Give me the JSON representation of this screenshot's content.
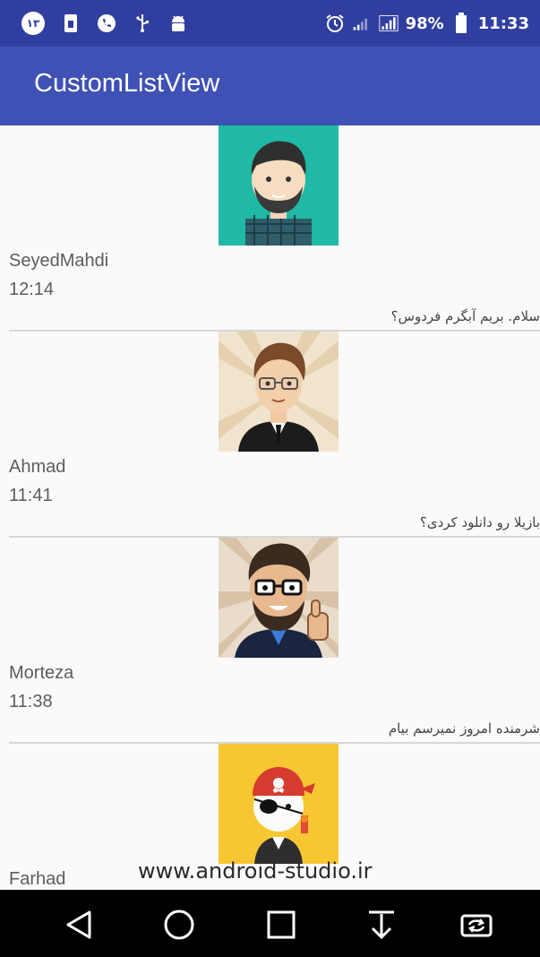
{
  "status_bar": {
    "left_icons": [
      "notification-count-badge",
      "sim-icon",
      "phone-icon",
      "usb-icon",
      "android-debug-icon"
    ],
    "badge_text": "۱۳",
    "battery_percent": "98%",
    "time": "11:33",
    "right_icons": [
      "alarm-icon",
      "signal-icon",
      "signal-icon-2",
      "battery-icon"
    ]
  },
  "app_bar": {
    "title": "CustomListView",
    "background": "#3f51b5",
    "status_background": "#303f9f"
  },
  "contacts": [
    {
      "name": "SeyedMahdi",
      "time": "12:14",
      "message": "سلام. بریم آبگرم فردوس؟",
      "avatar_icon": "avatar-bearded-man-icon"
    },
    {
      "name": "Ahmad",
      "time": "11:41",
      "message": "بازیلا رو دانلود کردی؟",
      "avatar_icon": "avatar-glasses-suit-icon"
    },
    {
      "name": "Morteza",
      "time": "11:38",
      "message": "شرمنده امروز نمیرسم بیام",
      "avatar_icon": "avatar-thumbs-up-icon"
    },
    {
      "name": "Farhad",
      "time": "",
      "message": "",
      "avatar_icon": "avatar-pirate-icon"
    }
  ],
  "watermark": "www.android-studio.ir",
  "nav_bar": {
    "buttons": [
      "back-icon",
      "home-icon",
      "recents-icon",
      "notification-pull-icon",
      "screen-rotate-icon"
    ]
  }
}
